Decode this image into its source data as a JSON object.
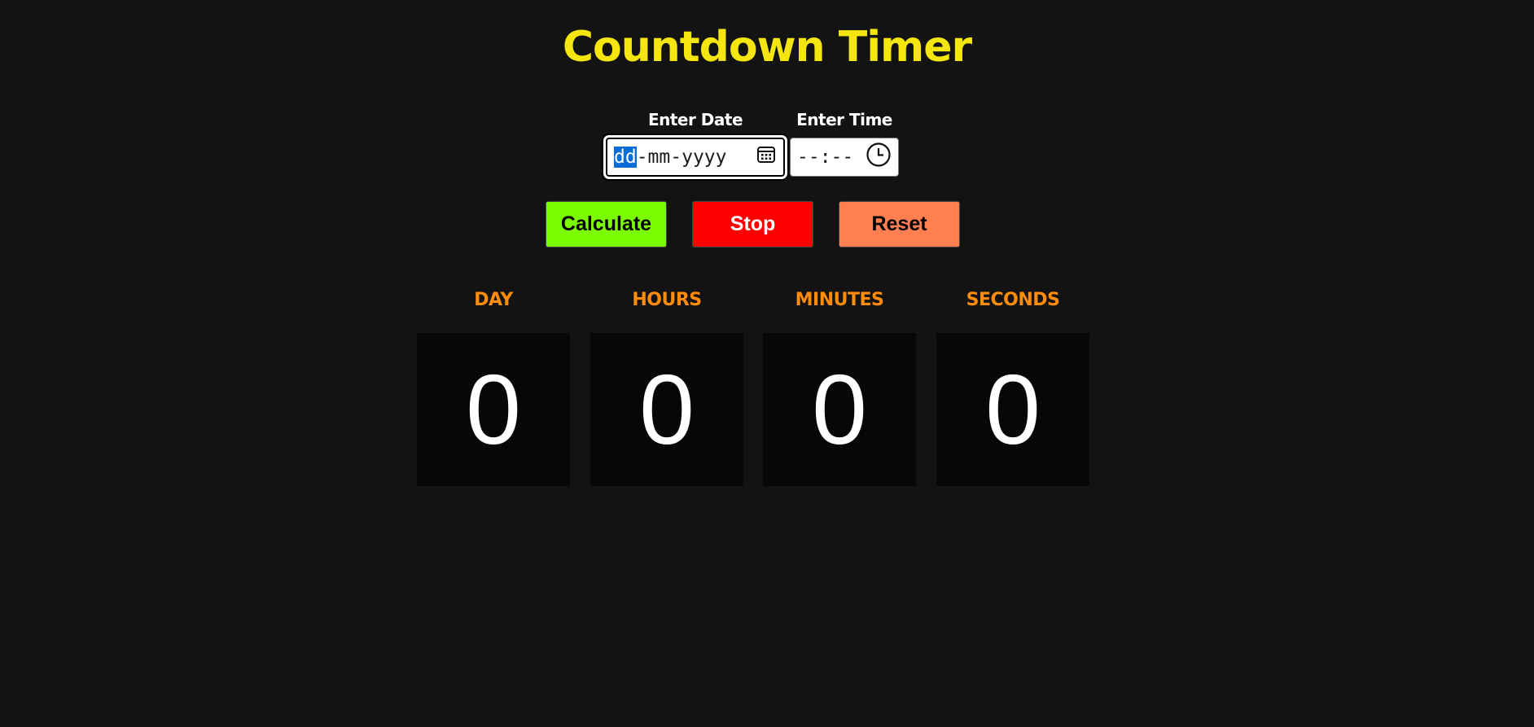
{
  "title": "Countdown Timer",
  "colors": {
    "title": "#f5e60f",
    "unit_label": "#ff8c0a",
    "calculate_bg": "#7cfc00",
    "stop_bg": "#ff0000",
    "reset_bg": "#ff7f50"
  },
  "date_input": {
    "label": "Enter Date",
    "day_segment": "dd",
    "rest_segments": "-mm-yyyy",
    "icon": "calendar-icon"
  },
  "time_input": {
    "label": "Enter Time",
    "value": "--:--",
    "icon": "clock-icon"
  },
  "buttons": {
    "calculate": "Calculate",
    "stop": "Stop",
    "reset": "Reset"
  },
  "units": [
    {
      "label": "DAY",
      "value": "0"
    },
    {
      "label": "HOURS",
      "value": "0"
    },
    {
      "label": "MINUTES",
      "value": "0"
    },
    {
      "label": "SECONDS",
      "value": "0"
    }
  ]
}
